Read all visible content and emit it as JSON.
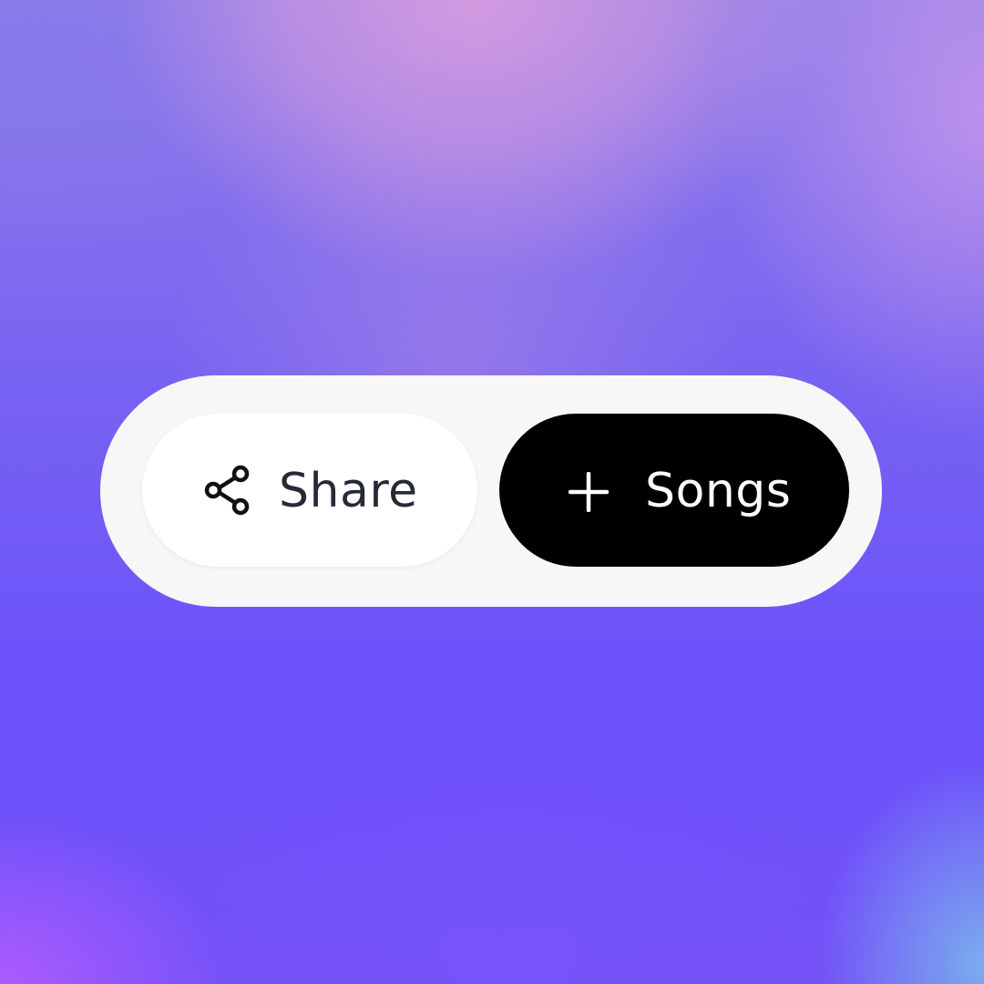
{
  "background": {
    "colors": [
      "#d69ce0",
      "#6f58f4",
      "#af5cff",
      "#7ab2ee"
    ]
  },
  "toolbar": {
    "share": {
      "label": "Share",
      "icon": "share-icon"
    },
    "songs": {
      "label": "Songs",
      "icon": "plus-icon"
    }
  },
  "colors": {
    "container": "#f7f7f7",
    "share_button_bg": "#ffffff",
    "share_text": "#262a36",
    "songs_button_bg": "#000000",
    "songs_text": "#ffffff"
  }
}
